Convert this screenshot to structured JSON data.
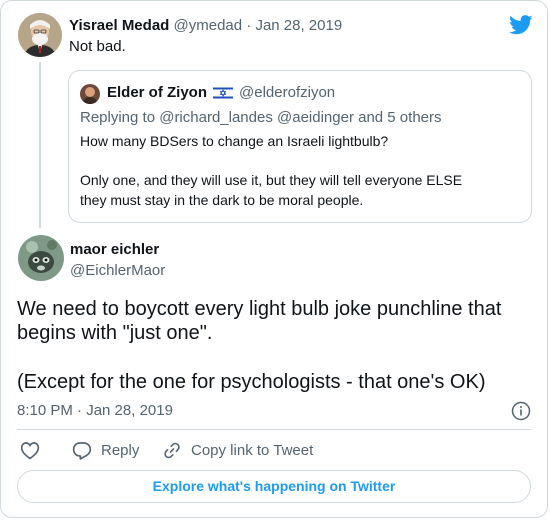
{
  "parent_tweet": {
    "author_name": "Yisrael Medad",
    "handle": "@ymedad",
    "separator": "·",
    "date": "Jan 28, 2019",
    "text": "Not bad."
  },
  "quoted_tweet": {
    "author_name": "Elder of Ziyon",
    "flag_icon": "israel-flag-icon",
    "handle": "@elderofziyon",
    "replying_to": "Replying to @richard_landes @aeidinger and 5 others",
    "line1": "How many BDSers to change an Israeli lightbulb?",
    "line2": "Only one, and they will use it, but they will tell everyone ELSE",
    "line3": "they must stay in the dark to be moral people."
  },
  "main_tweet": {
    "author_name": "maor eichler",
    "handle": "@EichlerMaor",
    "text_line1": "We need to boycott every light bulb joke punchline that",
    "text_line2": "begins with \"just one\".",
    "text_line3": "(Except for the one for psychologists - that one's OK)",
    "timestamp": "8:10 PM · Jan 28, 2019"
  },
  "actions": {
    "like_icon": "heart-icon",
    "reply_label": "Reply",
    "copy_link_label": "Copy link to Tweet"
  },
  "footer": {
    "explore_label": "Explore what's happening on Twitter"
  },
  "colors": {
    "twitter_blue": "#1d9bf0",
    "text": "#0f1419",
    "muted": "#536471",
    "border": "#cfd9de"
  }
}
